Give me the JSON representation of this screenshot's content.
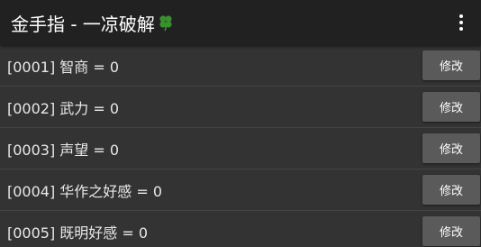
{
  "appbar": {
    "title": "金手指 - 一凉破解",
    "title_icon": "four-leaf-clover-icon",
    "menu_icon": "overflow-menu-icon"
  },
  "colors": {
    "appbar_bg": "#212121",
    "list_bg": "#333333",
    "button_bg": "#5a5a5a",
    "clover_green": "#3a8f2e"
  },
  "items": [
    {
      "text": "[0001] 智商 = 0",
      "button": "修改"
    },
    {
      "text": "[0002] 武力 = 0",
      "button": "修改"
    },
    {
      "text": "[0003] 声望 = 0",
      "button": "修改"
    },
    {
      "text": "[0004] 华作之好感 = 0",
      "button": "修改"
    },
    {
      "text": "[0005] 既明好感 = 0",
      "button": "修改"
    }
  ]
}
